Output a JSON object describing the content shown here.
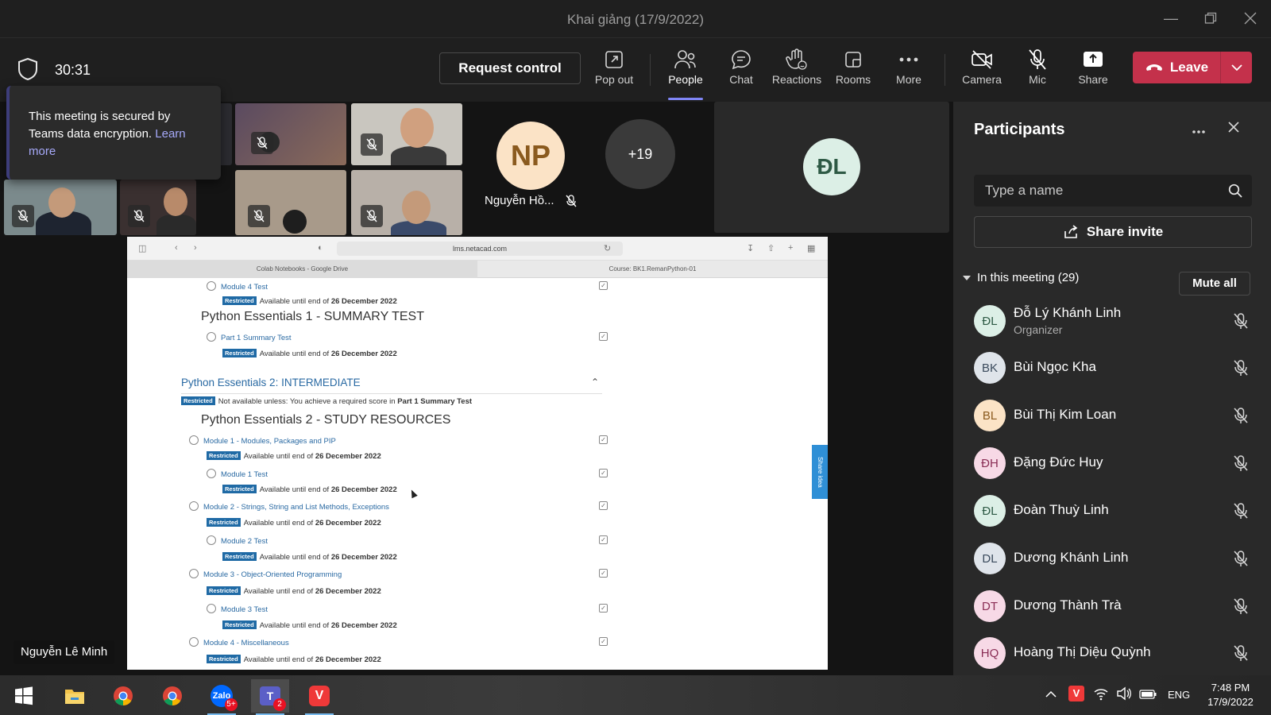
{
  "window": {
    "title": "Khai giảng (17/9/2022)"
  },
  "toolbar": {
    "timer": "30:31",
    "request_control": "Request control",
    "buttons": {
      "popout": "Pop out",
      "people": "People",
      "chat": "Chat",
      "reactions": "Reactions",
      "rooms": "Rooms",
      "more": "More",
      "camera": "Camera",
      "mic": "Mic",
      "share": "Share"
    },
    "leave": "Leave",
    "leave_color": "#c4314b",
    "accent": "#7f85f5"
  },
  "encryption_tip": {
    "text": "This meeting is secured by Teams data encryption.",
    "link": "Learn more"
  },
  "stage": {
    "np_avatar": {
      "initials": "NP",
      "name": "Nguyễn Hồ...",
      "color": "#fbe3c6",
      "text_color": "#8a5a1e"
    },
    "overflow_count": "+19",
    "dl_avatar": {
      "initials": "ĐL",
      "color": "#dcefe6",
      "text_color": "#2e5a45"
    },
    "presenter_name": "Nguyễn Lê Minh"
  },
  "shared_screen": {
    "url": "lms.netacad.com",
    "tabs": [
      "Colab Notebooks - Google Drive",
      "Course: BK1.RemanPython-01"
    ],
    "restricted_label": "Restricted",
    "available_text": "Available until end of",
    "deadline": "26 December 2022",
    "module4_test": "Module 4 Test",
    "summary_heading": "Python Essentials 1 - SUMMARY TEST",
    "part1_test": "Part 1 Summary Test",
    "section2_title": "Python Essentials 2: INTERMEDIATE",
    "not_available_text": "Not available unless: You achieve a required score in",
    "required_item": "Part 1 Summary Test",
    "study_heading": "Python Essentials 2 - STUDY RESOURCES",
    "items": [
      {
        "label": "Module 1 - Modules, Packages and PIP",
        "level": 1
      },
      {
        "label": "Module 1 Test",
        "level": 2
      },
      {
        "label": "Module 2 - Strings, String and List Methods, Exceptions",
        "level": 1
      },
      {
        "label": "Module 2 Test",
        "level": 2
      },
      {
        "label": "Module 3 - Object-Oriented Programming",
        "level": 1
      },
      {
        "label": "Module 3 Test",
        "level": 2
      },
      {
        "label": "Module 4 - Miscellaneous",
        "level": 1
      }
    ],
    "share_idea": "Share idea"
  },
  "participants": {
    "title": "Participants",
    "search_placeholder": "Type a name",
    "share_invite": "Share invite",
    "in_meeting": "In this meeting (29)",
    "mute_all": "Mute all",
    "list": [
      {
        "initials": "ĐL",
        "name": "Đỗ Lý Khánh Linh",
        "role": "Organizer",
        "bg": "#dcefe6",
        "fg": "#2e5a45"
      },
      {
        "initials": "BK",
        "name": "Bùi Ngọc Kha",
        "role": "",
        "bg": "#dfe4ea",
        "fg": "#3a4a5c"
      },
      {
        "initials": "BL",
        "name": "Bùi Thị Kim Loan",
        "role": "",
        "bg": "#fbe3c6",
        "fg": "#8a5a1e"
      },
      {
        "initials": "ĐH",
        "name": "Đặng Đức Huy",
        "role": "",
        "bg": "#f7d9e6",
        "fg": "#8a2d55"
      },
      {
        "initials": "ĐL",
        "name": "Đoàn Thuỳ Linh",
        "role": "",
        "bg": "#dcefe6",
        "fg": "#2e5a45"
      },
      {
        "initials": "DL",
        "name": "Dương Khánh Linh",
        "role": "",
        "bg": "#dfe4ea",
        "fg": "#3a4a5c"
      },
      {
        "initials": "DT",
        "name": "Dương Thành Trà",
        "role": "",
        "bg": "#f7d9e6",
        "fg": "#8a2d55"
      },
      {
        "initials": "HQ",
        "name": "Hoàng Thị Diệu Quỳnh",
        "role": "",
        "bg": "#f7d9e6",
        "fg": "#8a2d55"
      }
    ]
  },
  "taskbar": {
    "time": "7:48 PM",
    "date": "17/9/2022",
    "lang": "ENG",
    "zalo_badge": "5+",
    "teams_badge": "2"
  }
}
